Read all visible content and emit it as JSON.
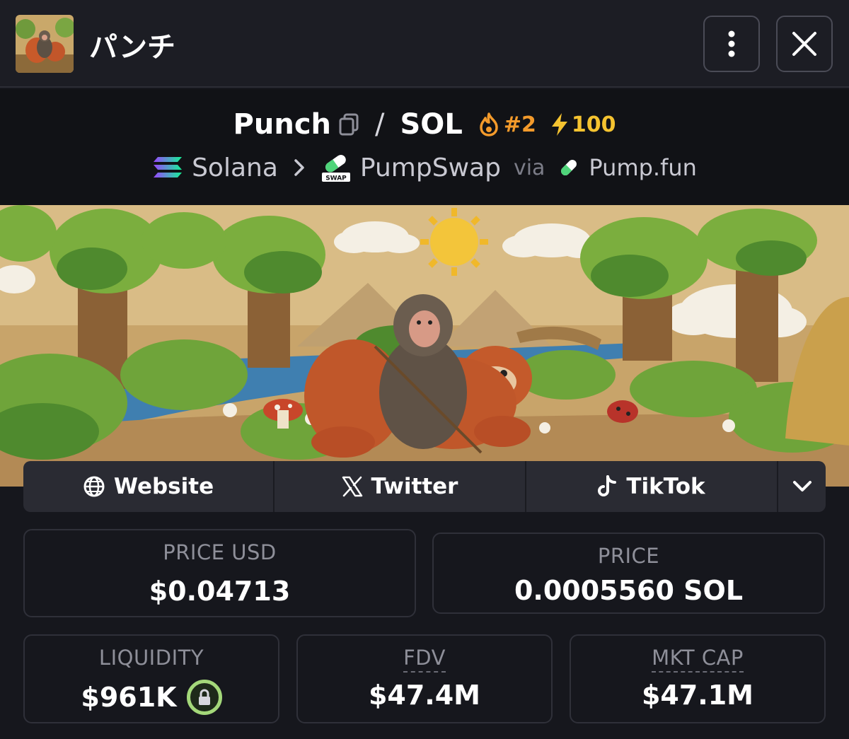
{
  "header": {
    "token_name": "パンチ"
  },
  "pair": {
    "base": "Punch",
    "separator": "/",
    "quote": "SOL",
    "rank": "#2",
    "boosts": "100",
    "chain": "Solana",
    "dex": "PumpSwap",
    "dex_badge": "SWAP",
    "via_label": "via",
    "launchpad": "Pump.fun"
  },
  "socials": {
    "website": "Website",
    "twitter": "Twitter",
    "tiktok": "TikTok"
  },
  "stats": {
    "price_usd_label": "PRICE USD",
    "price_usd": "$0.04713",
    "price_label": "PRICE",
    "price": "0.0005560 SOL",
    "liquidity_label": "LIQUIDITY",
    "liquidity": "$961K",
    "fdv_label": "FDV",
    "fdv": "$47.4M",
    "mcap_label": "MKT CAP",
    "mcap": "$47.1M"
  },
  "colors": {
    "background": "#16171d",
    "rank": "#f39a2b",
    "boost": "#f5c330",
    "lock": "#a4d87a"
  },
  "icons": [
    "token-thumbnail",
    "more-vertical-icon",
    "close-icon",
    "copy-icon",
    "fire-icon",
    "lightning-icon",
    "solana-icon",
    "chevron-right-icon",
    "pumpswap-icon",
    "pill-icon",
    "globe-icon",
    "x-logo-icon",
    "tiktok-icon",
    "chevron-down-icon",
    "lock-icon"
  ]
}
